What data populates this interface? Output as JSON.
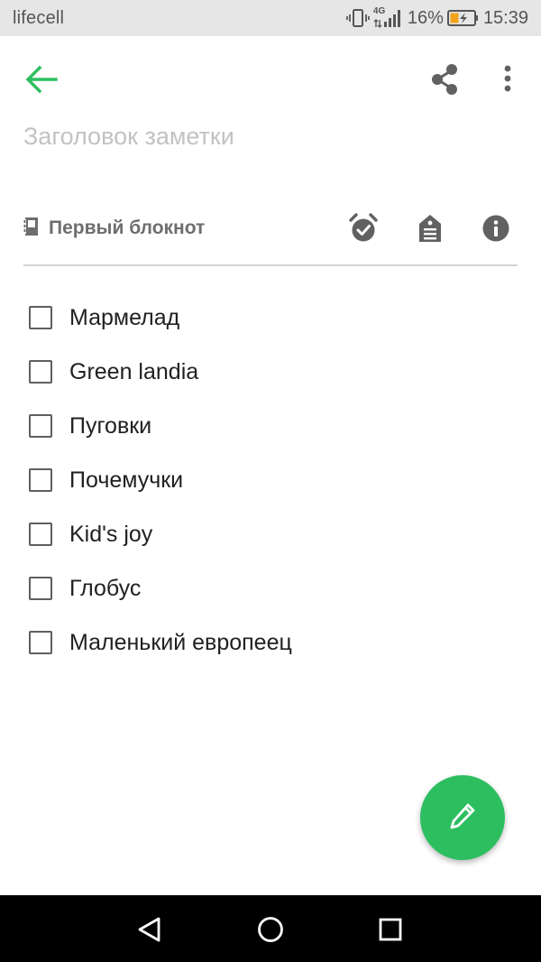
{
  "status_bar": {
    "carrier": "lifecell",
    "network_type": "4G",
    "battery_percent": "16%",
    "time": "15:39",
    "icons": [
      "vibrate-icon",
      "network-4g-icon",
      "signal-icon",
      "battery-icon"
    ]
  },
  "toolbar": {
    "icons": [
      "back-arrow-icon",
      "share-icon",
      "more-vert-icon"
    ]
  },
  "note": {
    "title_placeholder": "Заголовок заметки",
    "title_value": "",
    "notebook_icon": "notebook-icon",
    "notebook_name": "Первый блокнот",
    "meta_icons": [
      "reminder-icon",
      "tag-icon",
      "info-icon"
    ]
  },
  "checklist": [
    {
      "label": "Мармелад",
      "checked": false
    },
    {
      "label": "Green landia",
      "checked": false
    },
    {
      "label": "Пуговки",
      "checked": false
    },
    {
      "label": "Почемучки",
      "checked": false
    },
    {
      "label": "Kid's joy",
      "checked": false
    },
    {
      "label": "Глобус",
      "checked": false
    },
    {
      "label": "Маленький европеец",
      "checked": false
    }
  ],
  "fab": {
    "icon": "pencil-icon"
  },
  "nav_bar": {
    "icons": [
      "nav-back-icon",
      "nav-home-icon",
      "nav-recents-icon"
    ]
  },
  "colors": {
    "accent": "#2dbe60",
    "status_bar_bg": "#e6e6e6",
    "placeholder": "#c2c2c2",
    "secondary_text": "#6e6e6e",
    "icon_gray": "#616161",
    "nav_bar_bg": "#000000"
  }
}
